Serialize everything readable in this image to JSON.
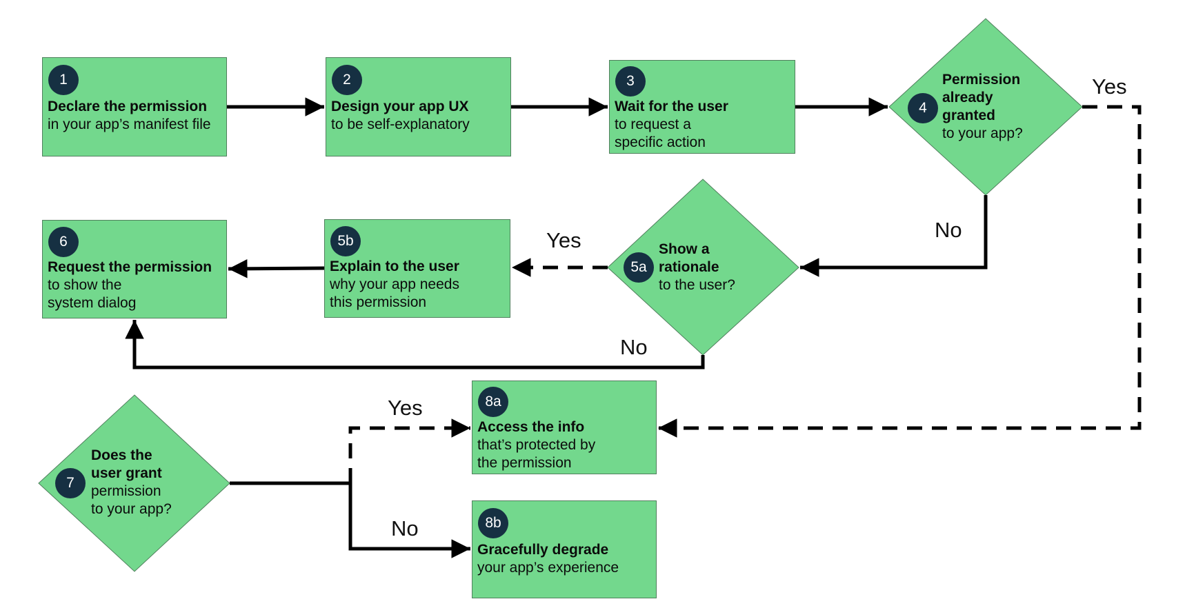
{
  "colors": {
    "node_fill": "#73d88d",
    "badge_fill": "#163042",
    "line": "#000000"
  },
  "nodes": {
    "n1": {
      "badge": "1",
      "title": "Declare the permission",
      "sub": "in your app’s manifest file"
    },
    "n2": {
      "badge": "2",
      "title": "Design your app UX",
      "sub": "to be self-explanatory"
    },
    "n3": {
      "badge": "3",
      "title": "Wait for the user",
      "sub": "to request a\nspecific action"
    },
    "n4": {
      "badge": "4",
      "title": "Permission\nalready\ngranted",
      "sub": "to your app?"
    },
    "n5a": {
      "badge": "5a",
      "title": "Show a\nrationale",
      "sub": "to the user?"
    },
    "n5b": {
      "badge": "5b",
      "title": "Explain to the user",
      "sub": "why your app needs\nthis permission"
    },
    "n6": {
      "badge": "6",
      "title": "Request the permission",
      "sub": "to show the\nsystem dialog"
    },
    "n7": {
      "badge": "7",
      "title": "Does the\nuser grant",
      "sub": "permission\nto your app?"
    },
    "n8a": {
      "badge": "8a",
      "title": "Access the info",
      "sub": "that’s protected by\nthe permission"
    },
    "n8b": {
      "badge": "8b",
      "title": "Gracefully degrade",
      "sub": "your app’s experience"
    }
  },
  "edge_labels": {
    "n4_yes": "Yes",
    "n4_no": "No",
    "n5a_yes": "Yes",
    "n5a_no": "No",
    "n7_yes": "Yes",
    "n7_no": "No"
  }
}
